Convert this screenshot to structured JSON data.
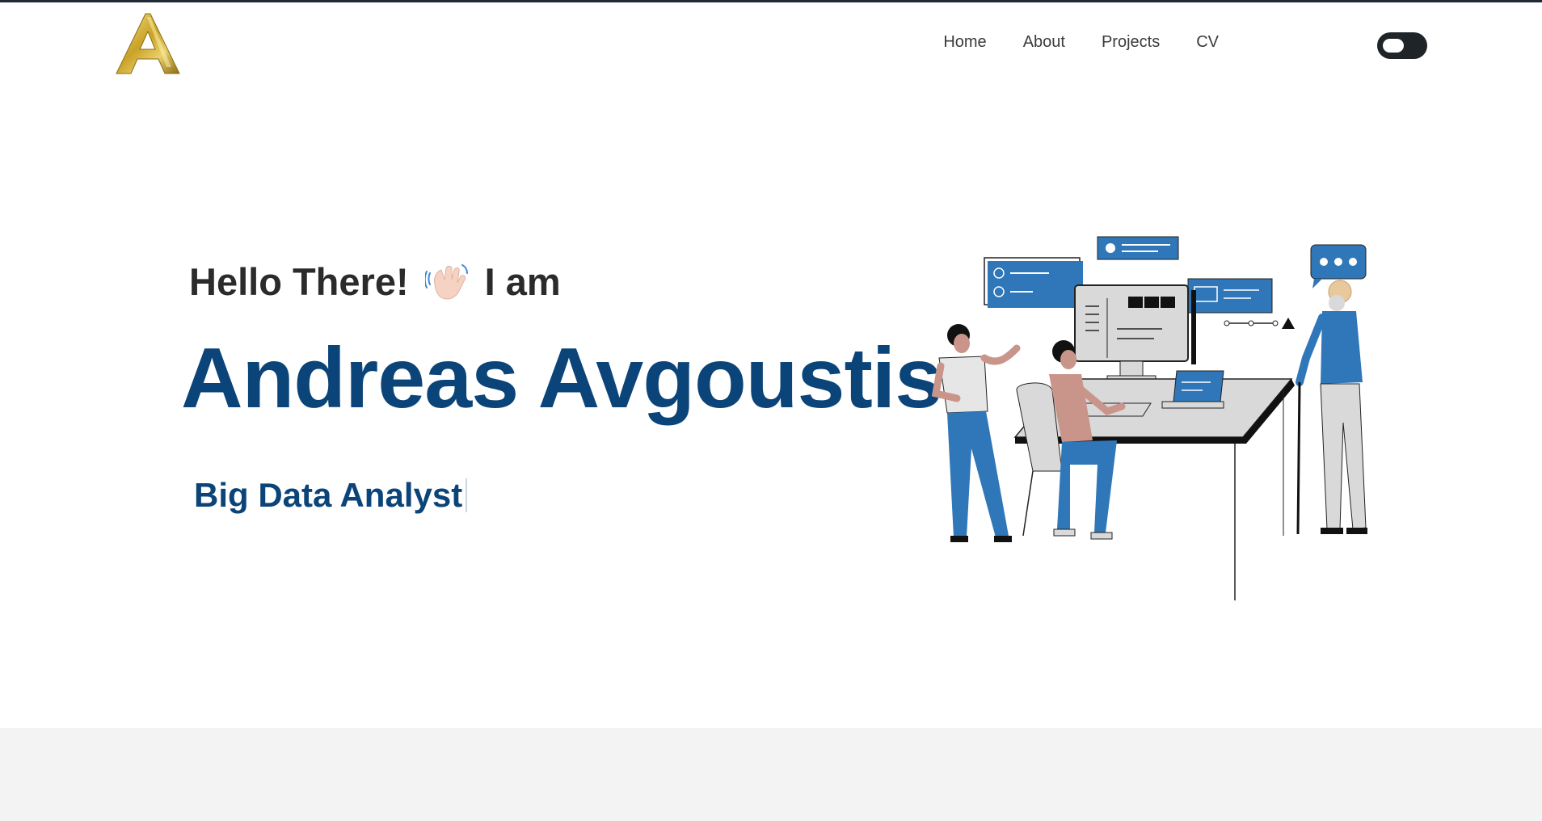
{
  "brand": {
    "logo_icon": "golden-letter-a-logo"
  },
  "nav": {
    "links": [
      "Home",
      "About",
      "Projects",
      "CV"
    ],
    "theme_toggle_icon": "dark-mode-toggle"
  },
  "hero": {
    "greeting_before": "Hello There!",
    "wave_icon": "waving-hand-icon",
    "greeting_after": "I am",
    "name": "Andreas Avgoustis",
    "role": "Big Data Analyst",
    "illustration": "team-working-at-computer-illustration"
  },
  "colors": {
    "accent": "#0b4478",
    "illustration_blue": "#2f77b9",
    "gold": "#c9a227",
    "footer_band": "#f4f3f4"
  }
}
